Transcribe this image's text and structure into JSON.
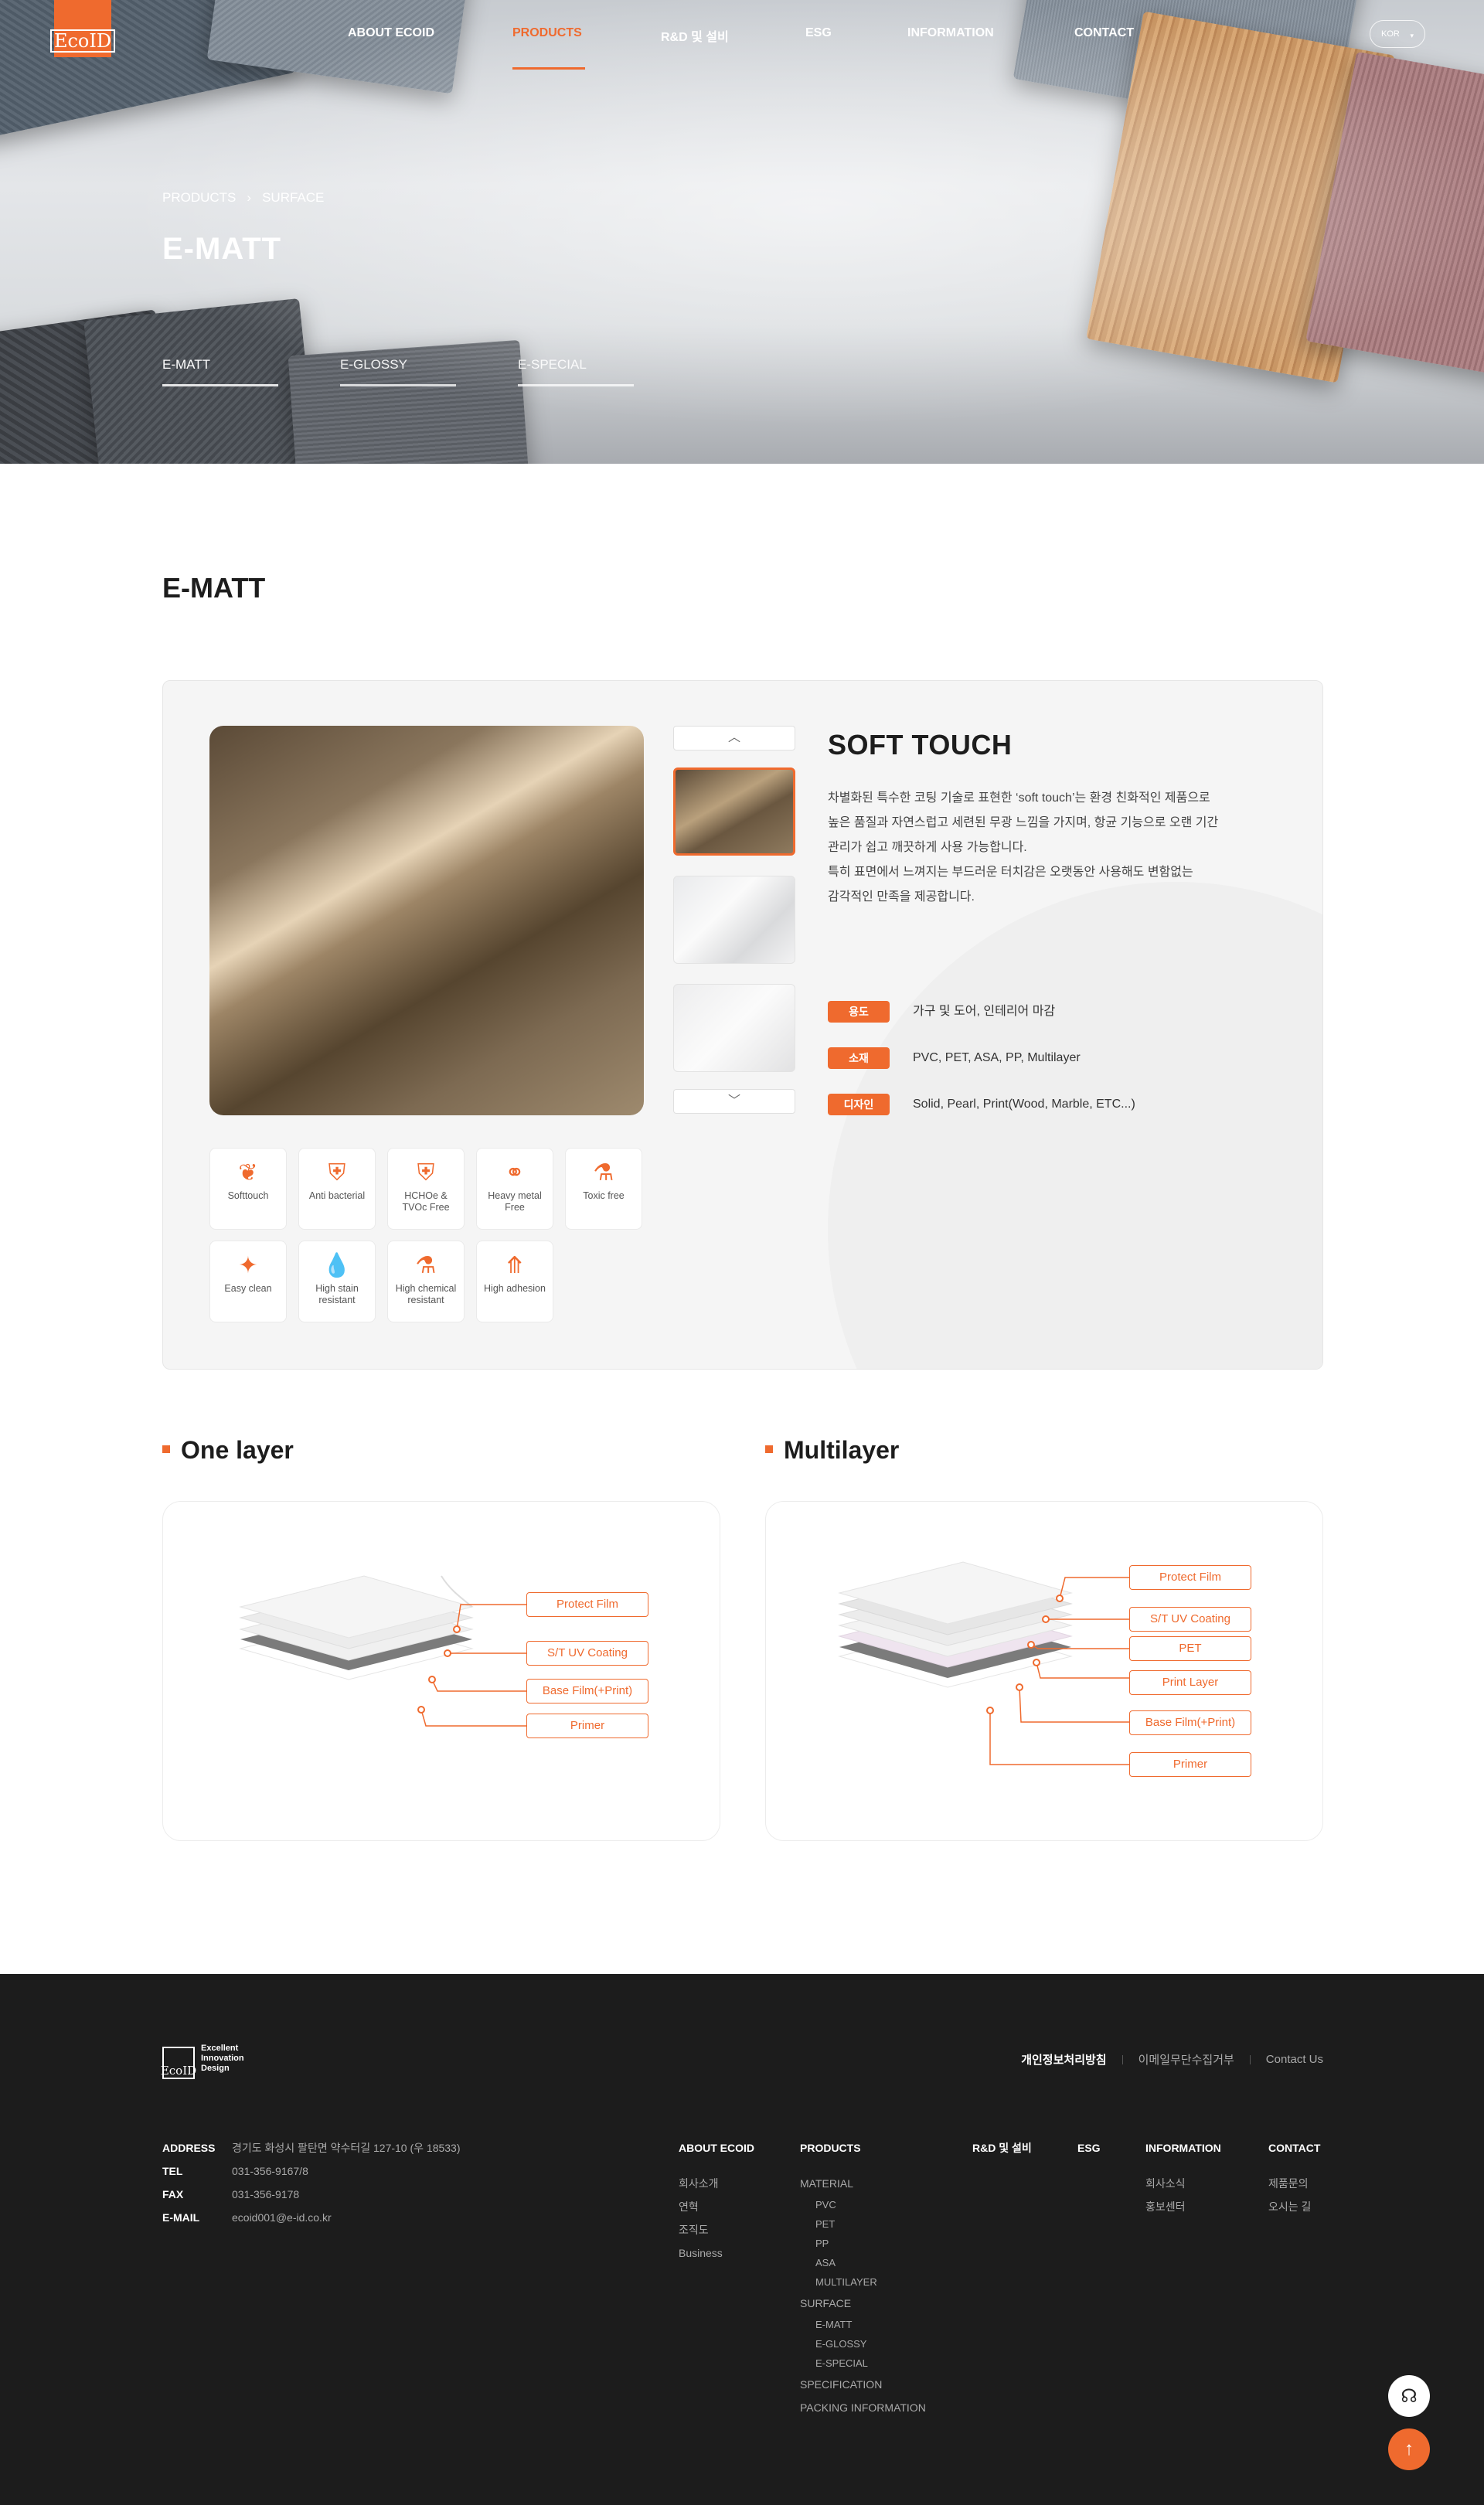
{
  "brand": {
    "logo": "EcoID",
    "accent": "#ef6a2e"
  },
  "nav": {
    "items": [
      "ABOUT ECOID",
      "PRODUCTS",
      "R&D 및 설비",
      "ESG",
      "INFORMATION",
      "CONTACT"
    ],
    "lang": "KOR"
  },
  "hero": {
    "breadcrumb": [
      "PRODUCTS",
      "SURFACE"
    ],
    "title": "E-MATT",
    "tabs": [
      "E-MATT",
      "E-GLOSSY",
      "E-SPECIAL"
    ]
  },
  "section": {
    "title": "E-MATT"
  },
  "product": {
    "name": "SOFT TOUCH",
    "desc": [
      "차별화된 특수한 코팅 기술로 표현한 ‘soft touch’는 환경 친화적인 제품으로",
      "높은 품질과 자연스럽고 세련된 무광 느낌을 가지며, 항균 기능으로 오랜 기간",
      "관리가 쉽고 깨끗하게 사용 가능합니다.",
      "특히 표면에서 느껴지는 부드러운 터치감은 오랫동안 사용해도 변함없는",
      "감각적인 만족을 제공합니다."
    ],
    "specs": [
      {
        "tag": "용도",
        "value": "가구 및 도어, 인테리어 마감"
      },
      {
        "tag": "소재",
        "value": "PVC, PET, ASA, PP, Multilayer"
      },
      {
        "tag": "디자인",
        "value": "Solid, Pearl, Print(Wood, Marble, ETC...)"
      }
    ],
    "features": [
      {
        "icon": "leaf-icon",
        "sym": "❦",
        "label": "Softtouch"
      },
      {
        "icon": "shield-icon",
        "sym": "⛨",
        "label": "Anti bacterial"
      },
      {
        "icon": "shield-leaf-icon",
        "sym": "⛨",
        "label": "HCHOe & TVOc Free"
      },
      {
        "icon": "molecule-icon",
        "sym": "⚭",
        "label": "Heavy metal Free"
      },
      {
        "icon": "flask-icon",
        "sym": "⚗",
        "label": "Toxic free"
      },
      {
        "icon": "sparkle-icon",
        "sym": "✦",
        "label": "Easy clean"
      },
      {
        "icon": "drops-icon",
        "sym": "💧",
        "label": "High stain resistant"
      },
      {
        "icon": "beaker-icon",
        "sym": "⚗",
        "label": "High chemical resistant"
      },
      {
        "icon": "adhesion-icon",
        "sym": "⤊",
        "label": "High adhesion"
      }
    ]
  },
  "layers": {
    "one": {
      "title": "One layer",
      "labels": [
        "Protect Film",
        "S/T UV Coating",
        "Base Film(+Print)",
        "Primer"
      ]
    },
    "multi": {
      "title": "Multilayer",
      "labels": [
        "Protect Film",
        "S/T UV Coating",
        "PET",
        "Print Layer",
        "Base Film(+Print)",
        "Primer"
      ]
    }
  },
  "footer": {
    "slogan": [
      "Excellent",
      "Innovation",
      "Design"
    ],
    "links": [
      "개인정보처리방침",
      "이메일무단수집거부",
      "Contact Us"
    ],
    "info": [
      {
        "k": "ADDRESS",
        "v": "경기도 화성시 팔탄면 약수터길 127-10 (우 18533)"
      },
      {
        "k": "TEL",
        "v": "031-356-9167/8"
      },
      {
        "k": "FAX",
        "v": "031-356-9178"
      },
      {
        "k": "E-MAIL",
        "v": "ecoid001@e-id.co.kr"
      }
    ],
    "cols": {
      "about": {
        "h": "ABOUT ECOID",
        "items": [
          "회사소개",
          "연혁",
          "조직도",
          "Business"
        ]
      },
      "products": {
        "h": "PRODUCTS",
        "material": "MATERIAL",
        "materials": [
          "PVC",
          "PET",
          "PP",
          "ASA",
          "MULTILAYER"
        ],
        "surface": "SURFACE",
        "surfaces": [
          "E-MATT",
          "E-GLOSSY",
          "E-SPECIAL"
        ],
        "extra": [
          "SPECIFICATION",
          "PACKING INFORMATION"
        ]
      },
      "rnd": {
        "h": "R&D 및 설비"
      },
      "esg": {
        "h": "ESG"
      },
      "information": {
        "h": "INFORMATION",
        "items": [
          "회사소식",
          "홍보센터"
        ]
      },
      "contact": {
        "h": "CONTACT",
        "items": [
          "제품문의",
          "오시는 길"
        ]
      }
    }
  }
}
